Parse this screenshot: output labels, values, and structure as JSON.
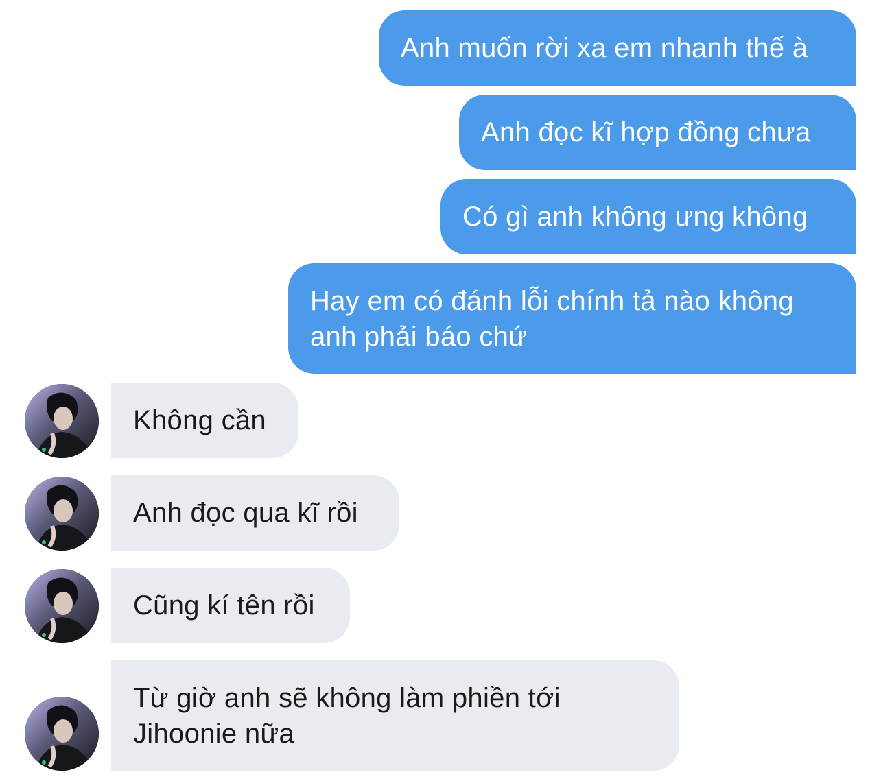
{
  "conversation": {
    "outgoing": [
      "Anh muốn rời xa em nhanh thế à",
      "Anh đọc kĩ hợp đồng chưa",
      "Có gì anh không ưng không",
      "Hay em có đánh lỗi chính tả nào không\nanh phải báo chứ"
    ],
    "incoming": [
      "Không cần",
      "Anh đọc qua kĩ rồi",
      "Cũng kí tên rồi",
      "Từ giờ anh sẽ không làm phiền tới\nJihoonie nữa"
    ]
  },
  "colors": {
    "outgoing_bubble": "#4c9bea",
    "incoming_bubble": "#e8ecf0",
    "outgoing_text": "#ffffff",
    "incoming_text": "#1a1a1a"
  },
  "icons": {
    "avatar": "contact-avatar-photo"
  }
}
